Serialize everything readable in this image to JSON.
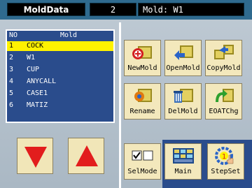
{
  "header": {
    "title": "MoldData",
    "count": "2",
    "mold_label": "Mold: W1"
  },
  "list": {
    "col_no": "NO",
    "col_mold": "Mold",
    "rows": [
      {
        "no": "1",
        "name": "COCK"
      },
      {
        "no": "2",
        "name": "W1"
      },
      {
        "no": "3",
        "name": "CUP"
      },
      {
        "no": "4",
        "name": "ANYCALL"
      },
      {
        "no": "5",
        "name": "CASE1"
      },
      {
        "no": "6",
        "name": "MATIZ"
      }
    ],
    "selected_index": 0
  },
  "buttons": {
    "new_mold": "NewMold",
    "open_mold": "OpenMold",
    "copy_mold": "CopyMold",
    "rename": "Rename",
    "del_mold": "DelMold",
    "eoat_chg": "EOATChg",
    "sel_mode": "SelMode",
    "main": "Main",
    "step_set": "StepSet"
  },
  "colors": {
    "top_bar": "#2f6a8e",
    "list_bg": "#2a4c8c",
    "selected_row": "#fff200",
    "arrow_red": "#e21d1d"
  },
  "icons": [
    "arrow-down-icon",
    "arrow-up-icon",
    "new-mold-icon",
    "open-mold-icon",
    "copy-mold-icon",
    "rename-icon",
    "delete-mold-icon",
    "eoat-change-icon",
    "select-mode-icon",
    "main-screen-icon",
    "step-set-icon"
  ]
}
